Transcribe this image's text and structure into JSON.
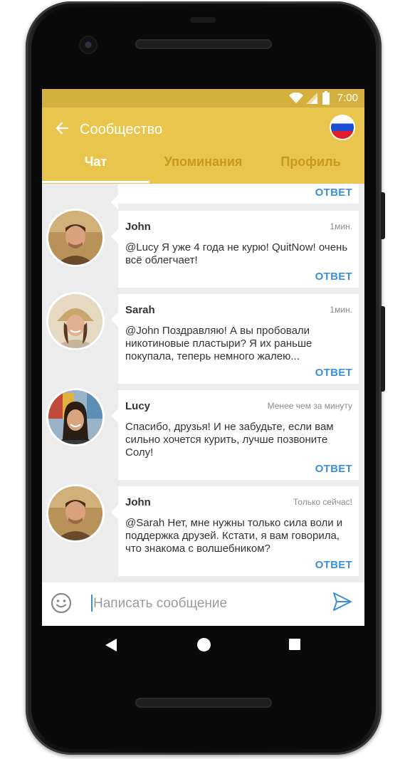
{
  "status_bar": {
    "time": "7:00"
  },
  "app_bar": {
    "title": "Сообщество",
    "tabs": [
      {
        "label": "Чат",
        "active": true
      },
      {
        "label": "Упоминания",
        "active": false
      },
      {
        "label": "Профиль",
        "active": false
      }
    ]
  },
  "colors": {
    "accent": "#e9c54d",
    "status_bar": "#d4b13e",
    "link": "#3b8fd6"
  },
  "reply_label": "ОТВЕТ",
  "messages": [
    {
      "author": "John",
      "time": "1мин.",
      "mention": "@Lucy",
      "text": " Я уже 4 года не курю! QuitNow! очень всё облегчает!"
    },
    {
      "author": "Sarah",
      "time": "1мин.",
      "mention": "@John",
      "text": " Поздравляю! А вы пробовали никотиновые пластыри? Я их раньше покупала, теперь немного жалею..."
    },
    {
      "author": "Lucy",
      "time": "Менее чем за минуту",
      "mention": "",
      "text": "Спасибо, друзья! И не забудьте, если вам сильно хочется курить, лучше позвоните Солу!"
    },
    {
      "author": "John",
      "time": "Только сейчас!",
      "mention": "@Sarah",
      "text": " Нет, мне нужны только сила воли и поддержка друзей. Кстати, я вам говорила, что знакома с волшебником?"
    }
  ],
  "composer": {
    "placeholder": "Написать сообщение"
  },
  "icons": {
    "back": "arrow-left-icon",
    "flag": "russia-flag-icon",
    "emoji": "smiley-icon",
    "send": "send-icon",
    "wifi": "wifi-icon",
    "signal": "signal-icon",
    "battery": "battery-icon"
  }
}
